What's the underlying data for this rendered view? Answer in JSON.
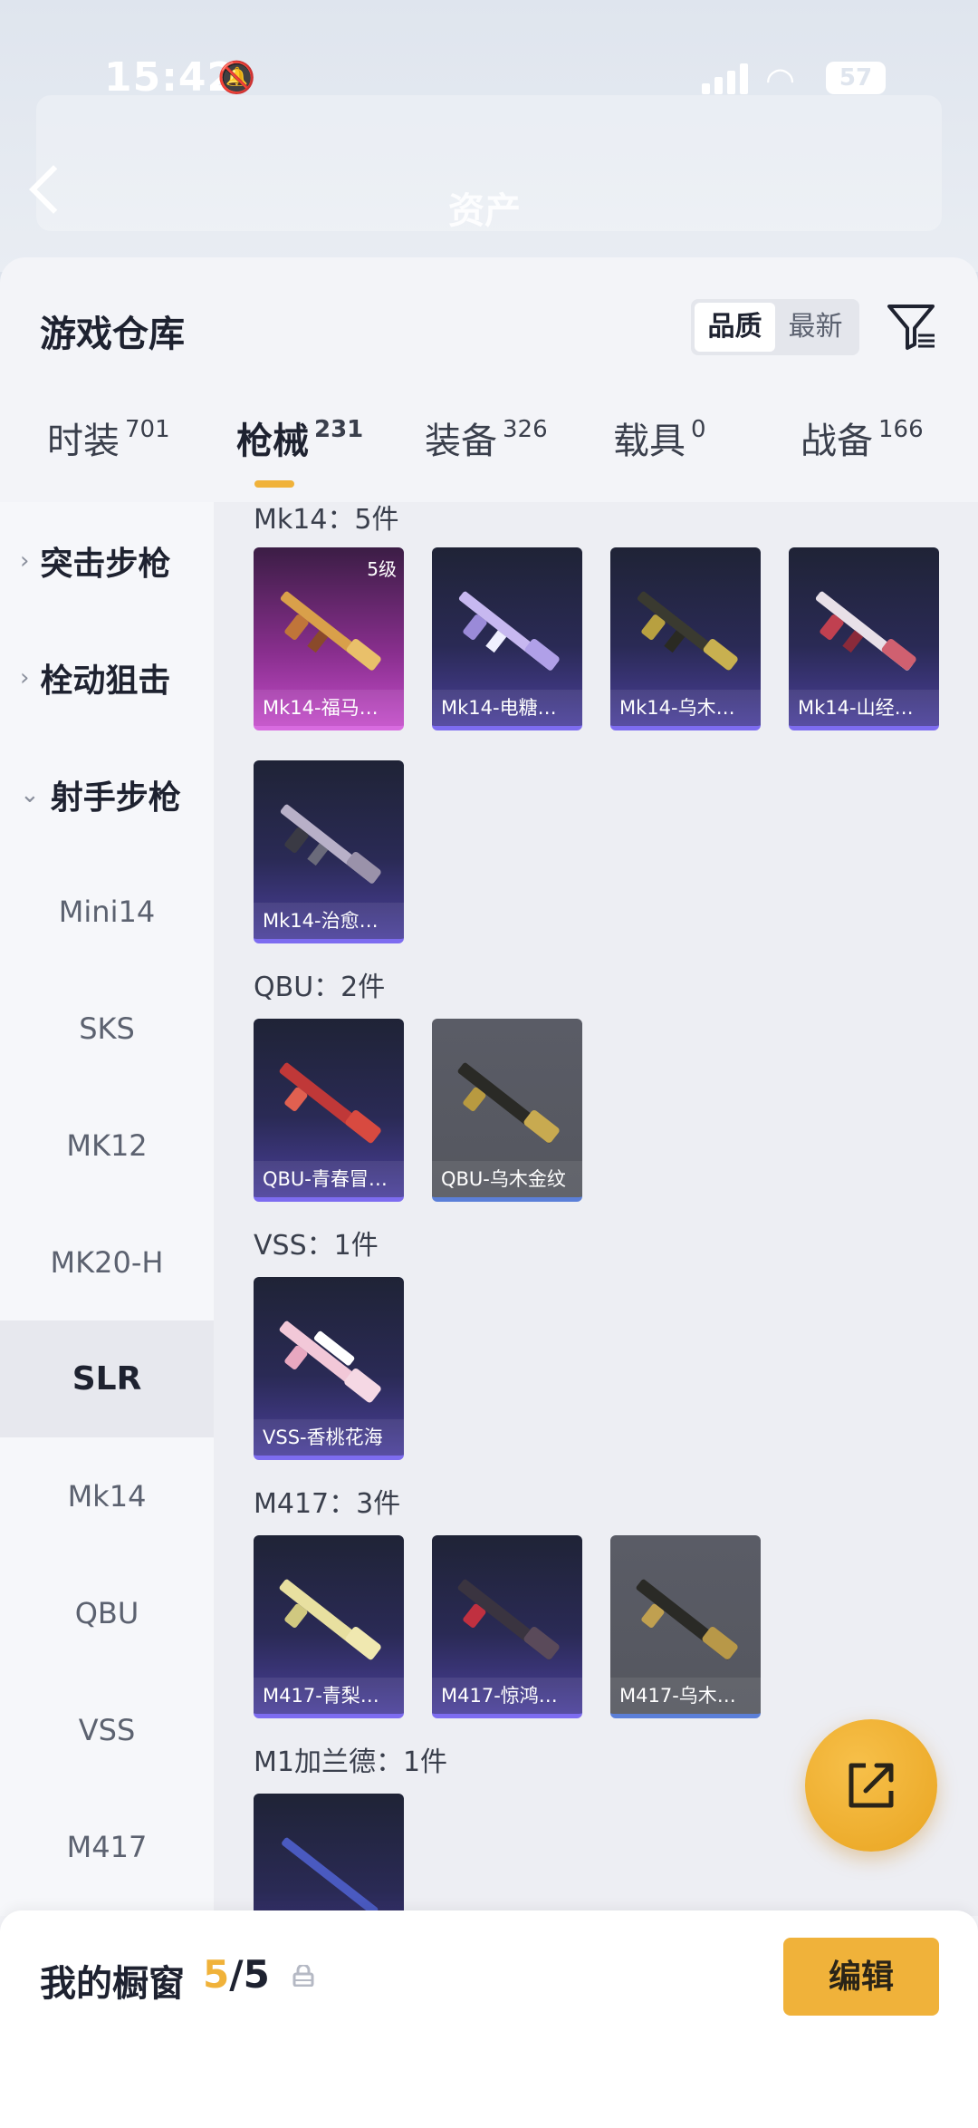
{
  "status_bar": {
    "time": "15:42",
    "battery": "57"
  },
  "header": {
    "title": "资产"
  },
  "sheet": {
    "title": "游戏仓库",
    "sort_options": [
      "品质",
      "最新"
    ],
    "active_sort": "品质"
  },
  "tabs": [
    {
      "label": "时装",
      "count": "701"
    },
    {
      "label": "枪械",
      "count": "231"
    },
    {
      "label": "装备",
      "count": "326"
    },
    {
      "label": "载具",
      "count": "0"
    },
    {
      "label": "战备",
      "count": "166"
    }
  ],
  "active_tab": "枪械",
  "sidebar": {
    "categories": [
      "突击步枪",
      "栓动狙击",
      "射手步枪"
    ],
    "subitems": [
      "Mini14",
      "SKS",
      "MK12",
      "MK20-H",
      "SLR",
      "Mk14",
      "QBU",
      "VSS",
      "M417"
    ],
    "selected": "SLR"
  },
  "groups": [
    {
      "title": "Mk14：5件",
      "items": [
        {
          "name": "Mk14-福马…",
          "level": "5级",
          "style": "pink"
        },
        {
          "name": "Mk14-电糖…",
          "style": "purple"
        },
        {
          "name": "Mk14-乌木…",
          "style": "purple"
        },
        {
          "name": "Mk14-山经…",
          "style": "purple"
        },
        {
          "name": "Mk14-治愈…",
          "style": "purple"
        }
      ]
    },
    {
      "title": "QBU：2件",
      "items": [
        {
          "name": "QBU-青春冒…",
          "style": "purple"
        },
        {
          "name": "QBU-乌木金纹",
          "style": "grey"
        }
      ]
    },
    {
      "title": "VSS：1件",
      "items": [
        {
          "name": "VSS-香桃花海",
          "style": "purple"
        }
      ]
    },
    {
      "title": "M417：3件",
      "items": [
        {
          "name": "M417-青梨…",
          "style": "purple"
        },
        {
          "name": "M417-惊鸿…",
          "style": "purple"
        },
        {
          "name": "M417-乌木…",
          "style": "grey"
        }
      ]
    },
    {
      "title": "M1加兰德：1件",
      "items": [
        {
          "name": "",
          "style": "purple"
        }
      ]
    }
  ],
  "bottom_bar": {
    "label": "我的橱窗",
    "count_current": "5",
    "count_total": "/5",
    "edit_label": "编辑"
  },
  "colors": {
    "accent": "#f0b23a",
    "rare_purple": "#7d6cf0",
    "legendary_pink": "#c24cc8"
  }
}
